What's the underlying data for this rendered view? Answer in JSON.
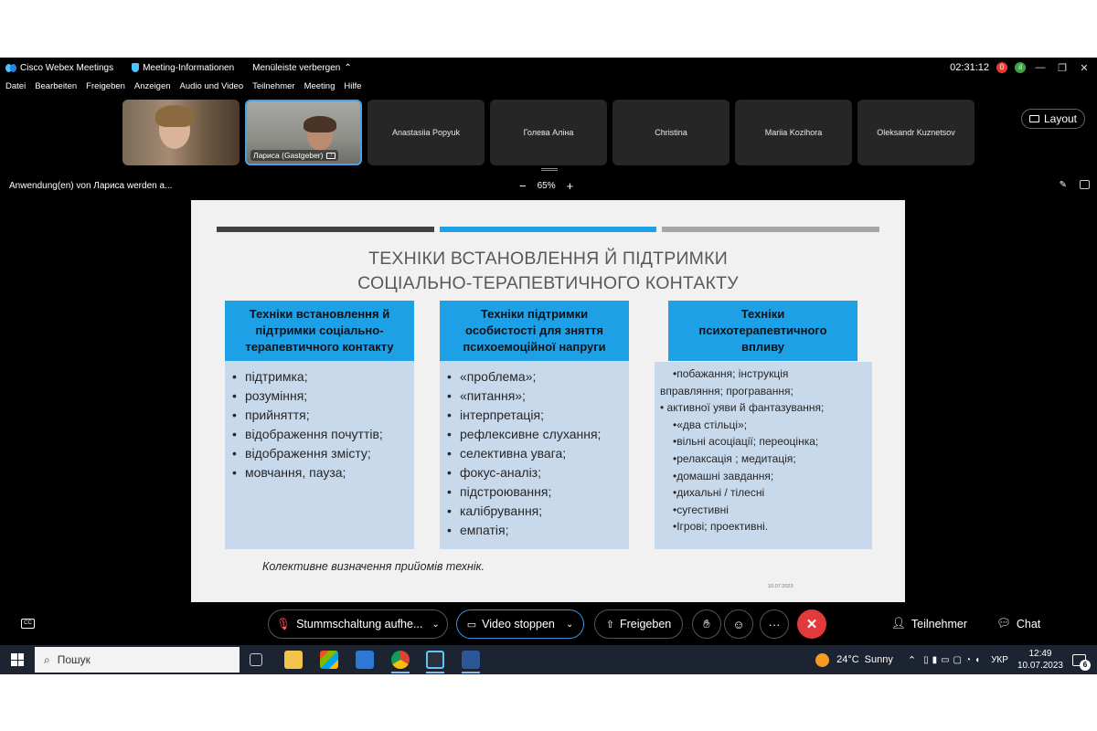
{
  "titlebar": {
    "app_name": "Cisco Webex Meetings",
    "meeting_info": "Meeting-Informationen",
    "hide_menu": "Menüleiste verbergen",
    "timer": "02:31:12",
    "recording_badge": "0"
  },
  "menu": [
    "Datei",
    "Bearbeiten",
    "Freigeben",
    "Anzeigen",
    "Audio und Video",
    "Teilnehmer",
    "Meeting",
    "Hilfe"
  ],
  "participants": {
    "host_label": "Лариса (Gastgeber)",
    "names": [
      "Anastasiia Popyuk",
      "Голева Аліна",
      "Christina",
      "Mariia Kozihora",
      "Oleksandr Kuznetsov"
    ],
    "layout_label": "Layout"
  },
  "share": {
    "status": "Anwendung(en) von Лариса werden a...",
    "zoom": "65%",
    "zoom_out": "−",
    "zoom_in": "+"
  },
  "slide": {
    "title_line1": "ТЕХНІКИ ВСТАНОВЛЕННЯ Й ПІДТРИМКИ",
    "title_line2": "СОЦІАЛЬНО-ТЕРАПЕВТИЧНОГО КОНТАКТУ",
    "bar_colors": [
      "#404040",
      "#1ea0e6",
      "#a6a6a6"
    ],
    "columns": [
      {
        "heading_lines": [
          "Техніки встановлення й",
          "підтримки соціально-",
          "терапевтичного контакту"
        ],
        "items": [
          "підтримка;",
          "розуміння;",
          "прийняття;",
          "відображення почуттів;",
          "відображення змісту;",
          "мовчання, пауза;"
        ]
      },
      {
        "heading_lines": [
          "Техніки підтримки",
          "особистості для зняття",
          "психоемоційної напруги"
        ],
        "items": [
          "«проблема»;",
          "«питання»;",
          "інтерпретація;",
          "рефлексивне слухання;",
          "селективна увага;",
          "фокус-аналіз;",
          "підстроювання;",
          "калібрування;",
          "емпатія;"
        ]
      },
      {
        "heading_lines": [
          "Техніки",
          "психотерапевтичного",
          "впливу"
        ],
        "lines": [
          "•побажання; інструкція",
          "вправляння; програвання;",
          "•    активної уяви й  фантазування;",
          "•«два стільці»;",
          "•вільні асоціації; переоцінка;",
          "•релаксація ;  медитація;",
          "•домашні завдання;",
          "•дихальні / тілесні",
          "•сугестивні",
          "•Ігрові; проективні."
        ]
      }
    ],
    "caption": "Колективне визначення прийомів технік.",
    "date": "10.07.2023"
  },
  "controls": {
    "mute": "Stummschaltung aufhe...",
    "video": "Video stoppen",
    "share": "Freigeben",
    "participants": "Teilnehmer",
    "chat": "Chat",
    "more": "···",
    "end": "✕"
  },
  "taskbar": {
    "search": "Пошук",
    "weather_temp": "24°C",
    "weather_text": "Sunny",
    "lang": "УКР",
    "time": "12:49",
    "date": "10.07.2023",
    "notifications": "6"
  },
  "colors": {
    "accent": "#1ea0e6",
    "slide_body": "#c9d9ec",
    "end_call": "#e23a3a",
    "taskbar": "#1c2432"
  }
}
